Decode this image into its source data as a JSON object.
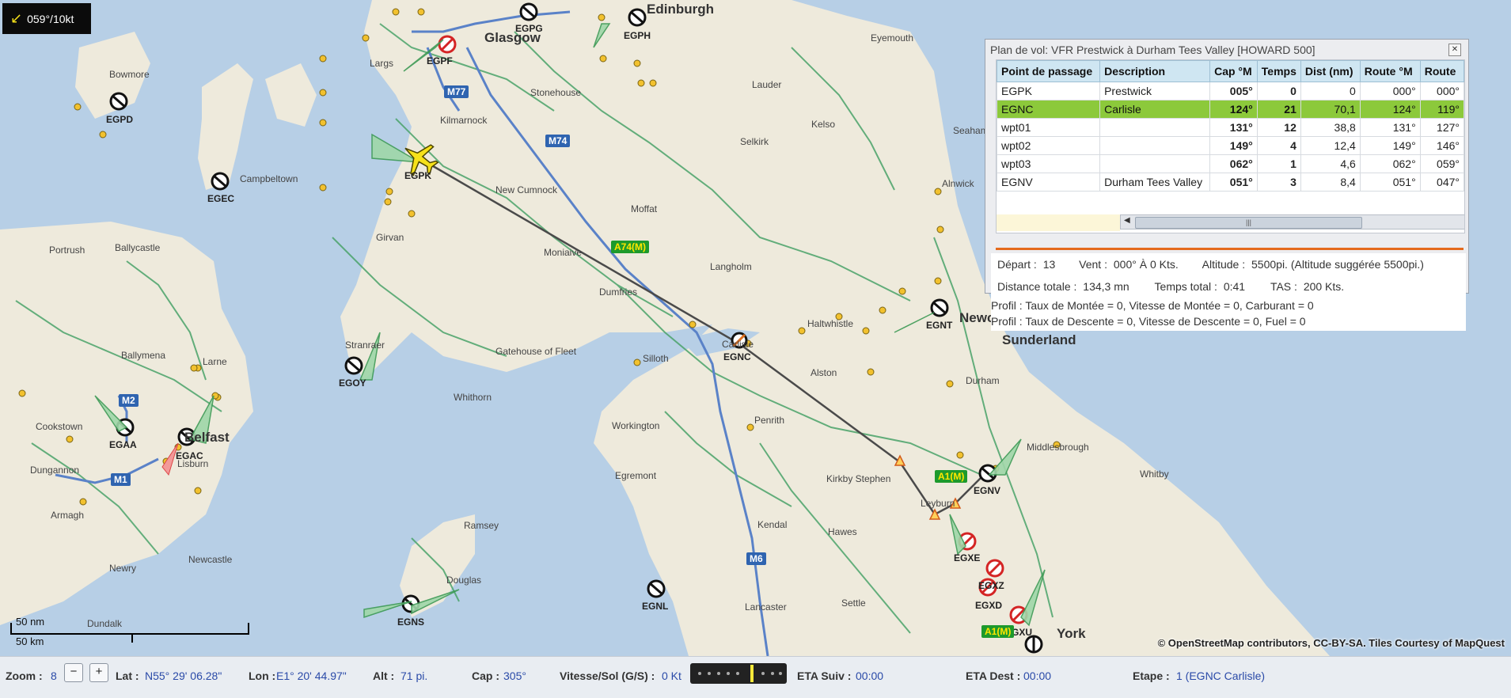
{
  "wind": {
    "value": "059°/10kt",
    "icon": "wind-arrow-icon"
  },
  "map": {
    "cities": [
      "Edinburgh",
      "Glasgow",
      "Newcastle upon Tyne",
      "Sunderland",
      "York",
      "Belfast"
    ],
    "towns": [
      "Largs",
      "Kilmarnock",
      "Stonehouse",
      "Lauder",
      "Kelso",
      "Selkirk",
      "Eyemouth",
      "Bowmore",
      "Campbeltown",
      "New Cumnock",
      "Moffat",
      "Girvan",
      "Ballycastle",
      "Portrush",
      "Moniaive",
      "Langholm",
      "Alnwick",
      "Dumfries",
      "Stranraer",
      "Ballymena",
      "Larne",
      "Gatehouse of Fleet",
      "Haltwhistle",
      "Silloth",
      "Alston",
      "Whithorn",
      "Cookstown",
      "Lisburn",
      "Workington",
      "Penrith",
      "Middlesbrough",
      "Dungannon",
      "Egremont",
      "Kirkby Stephen",
      "Whitby",
      "Armagh",
      "Ramsey",
      "Leyburn",
      "Hawes",
      "Kendal",
      "Newcastle",
      "Newry",
      "Douglas",
      "Settle",
      "Lancaster",
      "Dundalk",
      "Seaham",
      "Durham",
      "Carlisle"
    ],
    "airports": [
      "EGPK",
      "EGPD",
      "EGEC",
      "EGOY",
      "EGAA",
      "EGAC",
      "EGNC",
      "EGNT",
      "EGNV",
      "EGXE",
      "EGXZ",
      "EGXD",
      "EGXU",
      "EGNS",
      "EGNL",
      "EGPG",
      "EGPH",
      "EGPF"
    ],
    "roads": [
      "M77",
      "M74",
      "A74(M)",
      "M2",
      "M1",
      "M6",
      "A1(M)",
      "A1(M)"
    ],
    "attribution": "© OpenStreetMap contributors, CC-BY-SA. Tiles Courtesy of MapQuest",
    "scale": {
      "nm": "50 nm",
      "km": "50 km"
    }
  },
  "flight_plan": {
    "title": "Plan de vol: VFR Prestwick à Durham Tees Valley [HOWARD 500]",
    "columns": [
      "Point de passage",
      "Description",
      "Cap °M",
      "Temps",
      "Dist (nm)",
      "Route °M",
      "Route"
    ],
    "rows": [
      {
        "waypoint": "EGPK",
        "description": "Prestwick",
        "cap": "005°",
        "temps": "0",
        "dist": "0",
        "route_m": "000°",
        "route": "000°"
      },
      {
        "waypoint": "EGNC",
        "description": "Carlisle",
        "cap": "124°",
        "temps": "21",
        "dist": "70,1",
        "route_m": "124°",
        "route": "119°"
      },
      {
        "waypoint": "wpt01",
        "description": "",
        "cap": "131°",
        "temps": "12",
        "dist": "38,8",
        "route_m": "131°",
        "route": "127°"
      },
      {
        "waypoint": "wpt02",
        "description": "",
        "cap": "149°",
        "temps": "4",
        "dist": "12,4",
        "route_m": "149°",
        "route": "146°"
      },
      {
        "waypoint": "wpt03",
        "description": "",
        "cap": "062°",
        "temps": "1",
        "dist": "4,6",
        "route_m": "062°",
        "route": "059°"
      },
      {
        "waypoint": "EGNV",
        "description": "Durham Tees Valley",
        "cap": "051°",
        "temps": "3",
        "dist": "8,4",
        "route_m": "051°",
        "route": "047°"
      }
    ],
    "selected_row": 1,
    "summary": {
      "depart_label": "Départ :",
      "depart_value": "13",
      "vent_label": "Vent :",
      "vent_value": "000° À 0 Kts.",
      "altitude_label": "Altitude :",
      "altitude_value": "5500pi. (Altitude suggérée 5500pi.)",
      "distance_label": "Distance totale :",
      "distance_value": "134,3 mn",
      "temps_label": "Temps total :",
      "temps_value": "0:41",
      "tas_label": "TAS :",
      "tas_value": "200 Kts.",
      "profile_climb": "Profil : Taux de Montée = 0, Vitesse de Montée = 0, Carburant = 0",
      "profile_descent": "Profil : Taux de Descente = 0, Vitesse de Descente = 0, Fuel = 0"
    }
  },
  "statusbar": {
    "zoom_label": "Zoom :",
    "zoom_value": "8",
    "zoom_minus": "−",
    "zoom_plus": "+",
    "lat_label": "Lat :",
    "lat_value": "N55° 29' 06.28\"",
    "lon_label": "Lon :",
    "lon_value": "E1° 20' 44.97\"",
    "alt_label": "Alt :",
    "alt_value": "71 pi.",
    "cap_label": "Cap :",
    "cap_value": "305°",
    "speed_label": "Vitesse/Sol (G/S) :",
    "speed_value": "0 Kt",
    "eta_next_label": "ETA Suiv :",
    "eta_next_value": "00:00",
    "eta_dest_label": "ETA Dest :",
    "eta_dest_value": "00:00",
    "etape_label": "Etape :",
    "etape_value": "1 (EGNC Carlisle)"
  },
  "colors": {
    "sea": "#b7cfe6",
    "land": "#eeeadc",
    "route": "#4a4a4a",
    "selected_row": "#8cc93b",
    "accent": "#e46a1c"
  }
}
